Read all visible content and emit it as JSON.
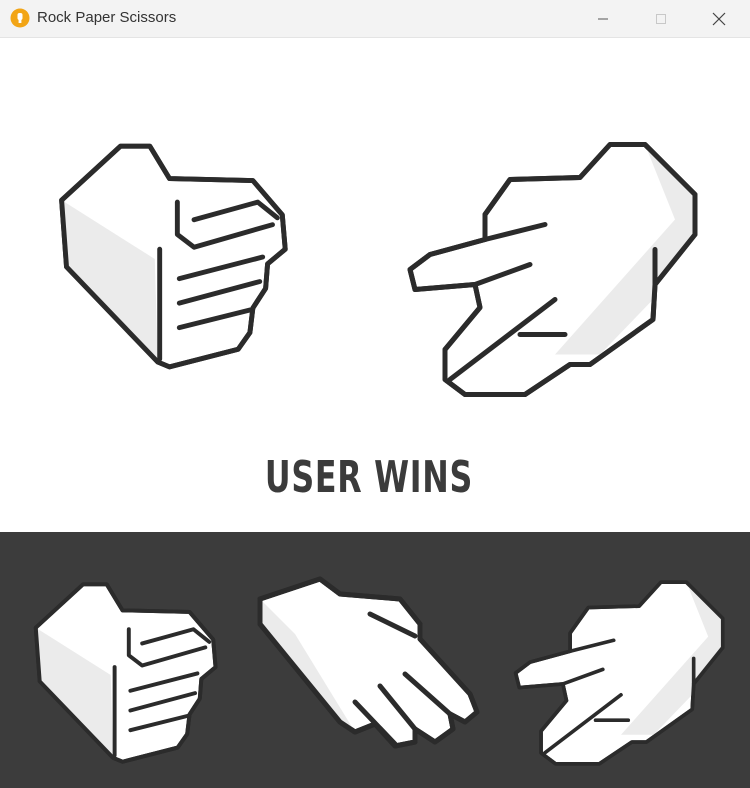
{
  "window": {
    "title": "Rock Paper Scissors"
  },
  "game": {
    "user_choice": "rock-icon",
    "computer_choice": "scissors-icon",
    "result_text": "USER WINS"
  },
  "choices": [
    {
      "id": "rock",
      "icon": "rock-icon"
    },
    {
      "id": "paper",
      "icon": "paper-icon"
    },
    {
      "id": "scissors",
      "icon": "scissors-icon"
    }
  ],
  "colors": {
    "titlebar": "#f3f3f3",
    "picker_bg": "#3c3c3c",
    "outline": "#2b2b2b",
    "hand_fill": "#ffffff",
    "hand_shade": "#e9e9e9",
    "result_text": "#3b3b3b"
  }
}
